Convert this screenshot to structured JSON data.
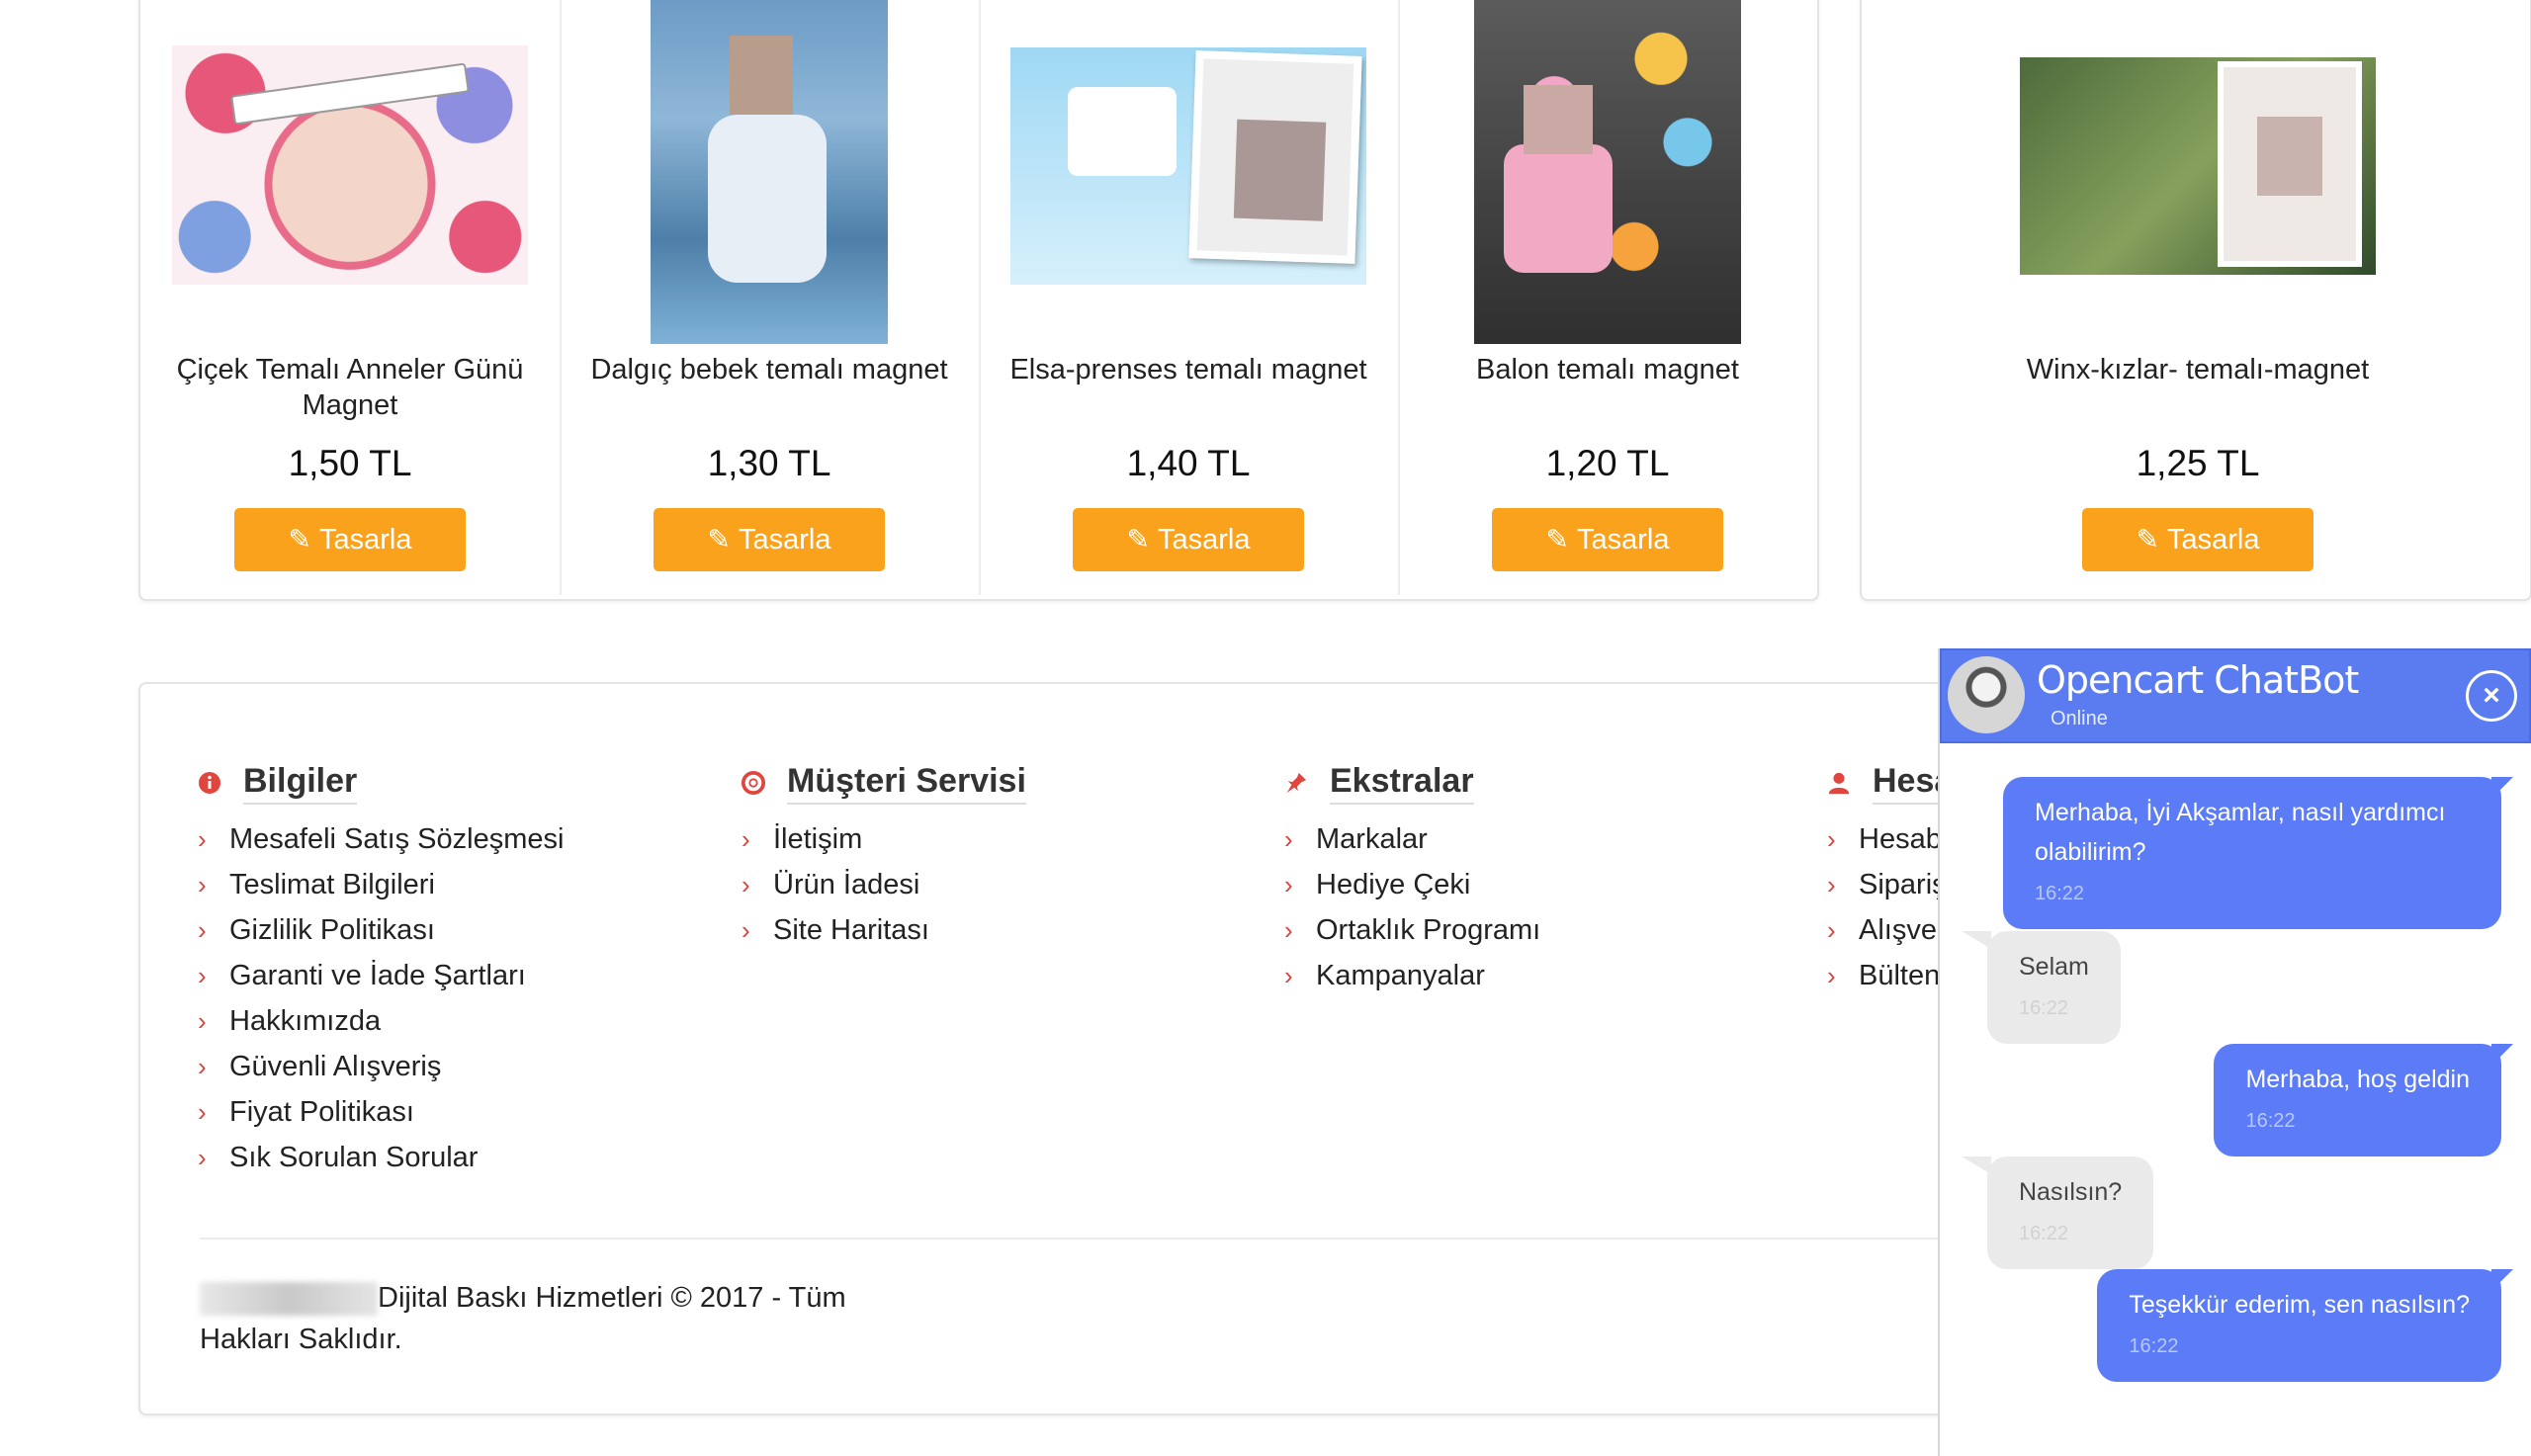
{
  "products": [
    {
      "name": "Çiçek Temalı Anneler Günü Magnet",
      "price": "1,50 TL",
      "button": "Tasarla"
    },
    {
      "name": "Dalgıç bebek temalı magnet",
      "price": "1,30 TL",
      "button": "Tasarla"
    },
    {
      "name": "Elsa-prenses temalı magnet",
      "price": "1,40 TL",
      "button": "Tasarla"
    },
    {
      "name": "Balon temalı magnet",
      "price": "1,20 TL",
      "button": "Tasarla"
    },
    {
      "name": "Winx-kızlar- temalı-magnet",
      "price": "1,25 TL",
      "button": "Tasarla"
    }
  ],
  "footer": {
    "columns": [
      {
        "title": "Bilgiler",
        "icon": "info-icon",
        "items": [
          "Mesafeli Satış Sözleşmesi",
          "Teslimat Bilgileri",
          "Gizlilik Politikası",
          "Garanti ve İade Şartları",
          "Hakkımızda",
          "Güvenli Alışveriş",
          "Fiyat Politikası",
          "Sık Sorulan Sorular"
        ]
      },
      {
        "title": "Müşteri Servisi",
        "icon": "lifebuoy-icon",
        "items": [
          "İletişim",
          "Ürün İadesi",
          "Site Haritası"
        ]
      },
      {
        "title": "Ekstralar",
        "icon": "pin-icon",
        "items": [
          "Markalar",
          "Hediye Çeki",
          "Ortaklık Programı",
          "Kampanyalar"
        ]
      },
      {
        "title": "Hesa",
        "icon": "user-icon",
        "items": [
          "Hesab",
          "Sipariş",
          "Alışver",
          "Bülten"
        ]
      }
    ],
    "copyright_line1": "Dijital Baskı Hizmetleri © 2017 - Tüm",
    "copyright_line2": "Hakları Saklıdır."
  },
  "chatbot": {
    "title": "Opencart ChatBot",
    "status": "Online",
    "close": "×",
    "messages": [
      {
        "from": "bot",
        "text": "Merhaba, İyi Akşamlar, nasıl yardımcı olabilirim?",
        "time": "16:22"
      },
      {
        "from": "user",
        "text": "Selam",
        "time": "16:22"
      },
      {
        "from": "bot",
        "text": "Merhaba, hoş geldin",
        "time": "16:22"
      },
      {
        "from": "user",
        "text": "Nasılsın?",
        "time": "16:22"
      },
      {
        "from": "bot",
        "text": "Teşekkür ederim, sen nasılsın?",
        "time": "16:22"
      }
    ]
  },
  "colors": {
    "accent_orange": "#fba21d",
    "chat_blue": "#5b7cf6",
    "icon_red": "#e0453e"
  }
}
